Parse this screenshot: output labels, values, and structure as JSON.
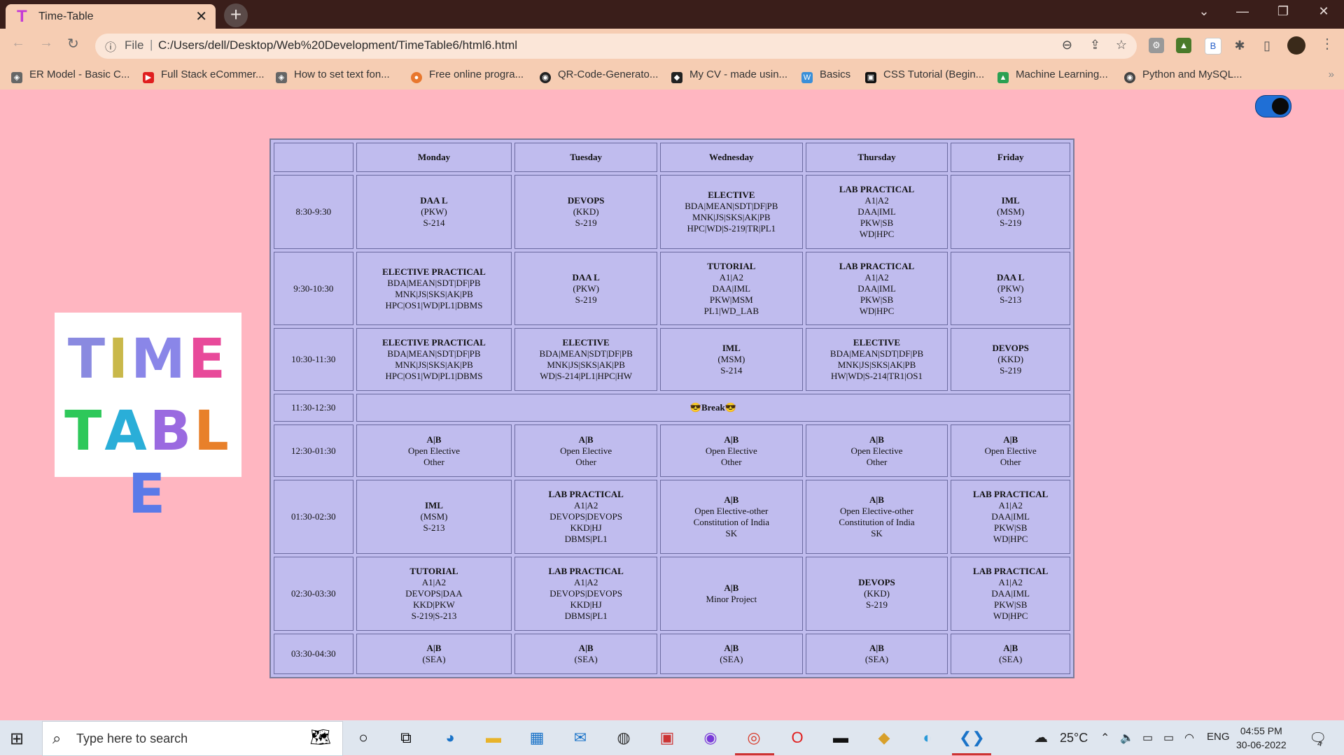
{
  "browser": {
    "tab_title": "Time-Table",
    "tab_logo": "T",
    "address_scheme": "File",
    "address_url": "C:/Users/dell/Desktop/Web%20Development/TimeTable6/html6.html",
    "bookmarks": [
      "ER Model - Basic C...",
      "Full Stack eCommer...",
      "How to set text fon...",
      "Free online progra...",
      "QR-Code-Generato...",
      "My CV - made usin...",
      "Basics",
      "CSS Tutorial (Begin...",
      "Machine Learning...",
      "Python and MySQL..."
    ],
    "bookmarks_more": "»"
  },
  "page": {
    "theme_toggle_on": true,
    "logo_line1": [
      "T",
      "I",
      "M",
      "E"
    ],
    "logo_line2": [
      "T",
      "A",
      "B",
      "L",
      "E"
    ],
    "colors": {
      "background": "#ffb6c1",
      "table": "#c0bcee",
      "toggle": "#1f6fd6"
    }
  },
  "timetable": {
    "days": [
      "",
      "Monday",
      "Tuesday",
      "Wednesday",
      "Thursday",
      "Friday"
    ],
    "rows": [
      {
        "time": "8:30-9:30",
        "cells": [
          [
            "DAA L",
            "(PKW)",
            "S-214"
          ],
          [
            "DEVOPS",
            "(KKD)",
            "S-219"
          ],
          [
            "ELECTIVE",
            "BDA|MEAN|SDT|DF|PB",
            "MNK|JS|SKS|AK|PB",
            "HPC|WD|S-219|TR|PL1"
          ],
          [
            "LAB PRACTICAL",
            "A1|A2",
            "DAA|IML",
            "PKW|SB",
            "WD|HPC"
          ],
          [
            "IML",
            "(MSM)",
            "S-219"
          ]
        ]
      },
      {
        "time": "9:30-10:30",
        "cells": [
          [
            "ELECTIVE PRACTICAL",
            "BDA|MEAN|SDT|DF|PB",
            "MNK|JS|SKS|AK|PB",
            "HPC|OS1|WD|PL1|DBMS"
          ],
          [
            "DAA L",
            "(PKW)",
            "S-219"
          ],
          [
            "TUTORIAL",
            "A1|A2",
            "DAA|IML",
            "PKW|MSM",
            "PL1|WD_LAB"
          ],
          [
            "LAB PRACTICAL",
            "A1|A2",
            "DAA|IML",
            "PKW|SB",
            "WD|HPC"
          ],
          [
            "DAA L",
            "(PKW)",
            "S-213"
          ]
        ]
      },
      {
        "time": "10:30-11:30",
        "cells": [
          [
            "ELECTIVE PRACTICAL",
            "BDA|MEAN|SDT|DF|PB",
            "MNK|JS|SKS|AK|PB",
            "HPC|OS1|WD|PL1|DBMS"
          ],
          [
            "ELECTIVE",
            "BDA|MEAN|SDT|DF|PB",
            "MNK|JS|SKS|AK|PB",
            "WD|S-214|PL1|HPC|HW"
          ],
          [
            "IML",
            "(MSM)",
            "S-214"
          ],
          [
            "ELECTIVE",
            "BDA|MEAN|SDT|DF|PB",
            "MNK|JS|SKS|AK|PB",
            "HW|WD|S-214|TR1|OS1"
          ],
          [
            "DEVOPS",
            "(KKD)",
            "S-219"
          ]
        ]
      },
      {
        "time": "11:30-12:30",
        "break": "😎Break😎"
      },
      {
        "time": "12:30-01:30",
        "cells": [
          [
            "A|B",
            "Open Elective",
            "Other"
          ],
          [
            "A|B",
            "Open Elective",
            "Other"
          ],
          [
            "A|B",
            "Open Elective",
            "Other"
          ],
          [
            "A|B",
            "Open Elective",
            "Other"
          ],
          [
            "A|B",
            "Open Elective",
            "Other"
          ]
        ]
      },
      {
        "time": "01:30-02:30",
        "cells": [
          [
            "IML",
            "(MSM)",
            "S-213"
          ],
          [
            "LAB PRACTICAL",
            "A1|A2",
            "DEVOPS|DEVOPS",
            "KKD|HJ",
            "DBMS|PL1"
          ],
          [
            "A|B",
            "Open Elective-other",
            "Constitution of India",
            "SK"
          ],
          [
            "A|B",
            "Open Elective-other",
            "Constitution of India",
            "SK"
          ],
          [
            "LAB PRACTICAL",
            "A1|A2",
            "DAA|IML",
            "PKW|SB",
            "WD|HPC"
          ]
        ]
      },
      {
        "time": "02:30-03:30",
        "cells": [
          [
            "TUTORIAL",
            "A1|A2",
            "DEVOPS|DAA",
            "KKD|PKW",
            "S-219|S-213"
          ],
          [
            "LAB PRACTICAL",
            "A1|A2",
            "DEVOPS|DEVOPS",
            "KKD|HJ",
            "DBMS|PL1"
          ],
          [
            "A|B",
            "Minor Project"
          ],
          [
            "DEVOPS",
            "(KKD)",
            "S-219"
          ],
          [
            "LAB PRACTICAL",
            "A1|A2",
            "DAA|IML",
            "PKW|SB",
            "WD|HPC"
          ]
        ]
      },
      {
        "time": "03:30-04:30",
        "cells": [
          [
            "A|B",
            "(SEA)"
          ],
          [
            "A|B",
            "(SEA)"
          ],
          [
            "A|B",
            "(SEA)"
          ],
          [
            "A|B",
            "(SEA)"
          ],
          [
            "A|B",
            "(SEA)"
          ]
        ]
      }
    ]
  },
  "taskbar": {
    "search_placeholder": "Type here to search",
    "weather": "25°C",
    "language": "ENG",
    "time": "04:55 PM",
    "date": "30-06-2022",
    "notifications": "4"
  }
}
